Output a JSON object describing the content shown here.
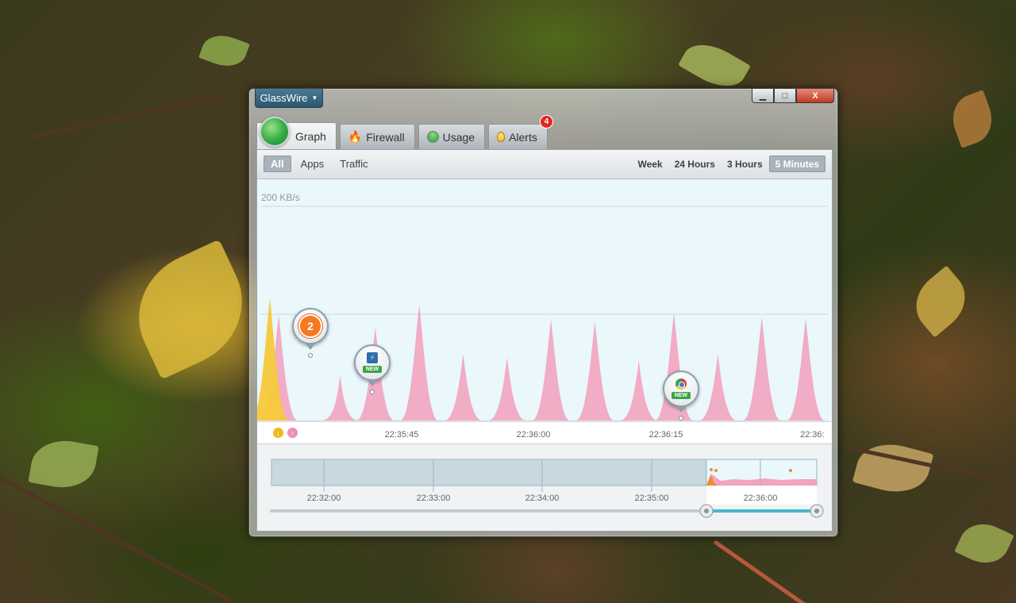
{
  "window": {
    "app_menu_label": "GlassWire",
    "controls": {
      "minimize": "▁",
      "maximize": "□",
      "close": "X"
    }
  },
  "tabs": [
    {
      "label": "Graph",
      "icon": "globe-icon",
      "active": true
    },
    {
      "label": "Firewall",
      "icon": "fire-icon",
      "active": false
    },
    {
      "label": "Usage",
      "icon": "usage-icon",
      "active": false
    },
    {
      "label": "Alerts",
      "icon": "bulb-icon",
      "active": false,
      "badge": "4"
    }
  ],
  "filters": [
    {
      "label": "All",
      "active": true
    },
    {
      "label": "Apps",
      "active": false
    },
    {
      "label": "Traffic",
      "active": false
    }
  ],
  "ranges": [
    {
      "label": "Week",
      "active": false
    },
    {
      "label": "24 Hours",
      "active": false
    },
    {
      "label": "3 Hours",
      "active": false
    },
    {
      "label": "5 Minutes",
      "active": true
    }
  ],
  "graph": {
    "scale_label": "200 KB/s",
    "time_ticks": [
      "22:35:45",
      "22:36:00",
      "22:36:15",
      "22:36:"
    ],
    "legend": {
      "download": "↓",
      "upload": "↑"
    },
    "markers": [
      {
        "type": "alert-count",
        "value": "2"
      },
      {
        "type": "new-app",
        "app_icon": "lightning-app-icon",
        "badge": "NEW"
      },
      {
        "type": "new-app",
        "app_icon": "chrome-icon",
        "badge": "NEW"
      }
    ],
    "colors": {
      "incoming": "#f2a3c0",
      "outgoing": "#f7c93a",
      "background": "#eaf7fb"
    }
  },
  "overview": {
    "time_ticks": [
      "22:32:00",
      "22:33:00",
      "22:34:00",
      "22:35:00",
      "22:36:00"
    ]
  },
  "chart_data": {
    "type": "area",
    "title": "",
    "xlabel": "",
    "ylabel": "",
    "ylim": [
      0,
      200
    ],
    "series": [
      {
        "name": "",
        "color": "#f2a3c0",
        "peaks": [
          {
            "t": "22:35:31",
            "value": 98
          },
          {
            "t": "22:35:38",
            "value": 42
          },
          {
            "t": "22:35:42",
            "value": 87
          },
          {
            "t": "22:35:47",
            "value": 108
          },
          {
            "t": "22:35:52",
            "value": 62
          },
          {
            "t": "22:35:57",
            "value": 59
          },
          {
            "t": "22:36:02",
            "value": 94
          },
          {
            "t": "22:36:07",
            "value": 92
          },
          {
            "t": "22:36:12",
            "value": 56
          },
          {
            "t": "22:36:16",
            "value": 100
          },
          {
            "t": "22:36:21",
            "value": 62
          },
          {
            "t": "22:36:26",
            "value": 96
          },
          {
            "t": "22:36:31",
            "value": 95
          }
        ]
      },
      {
        "name": "",
        "color": "#f7c93a",
        "peaks": [
          {
            "t": "22:35:30",
            "value": 114
          }
        ]
      }
    ]
  }
}
